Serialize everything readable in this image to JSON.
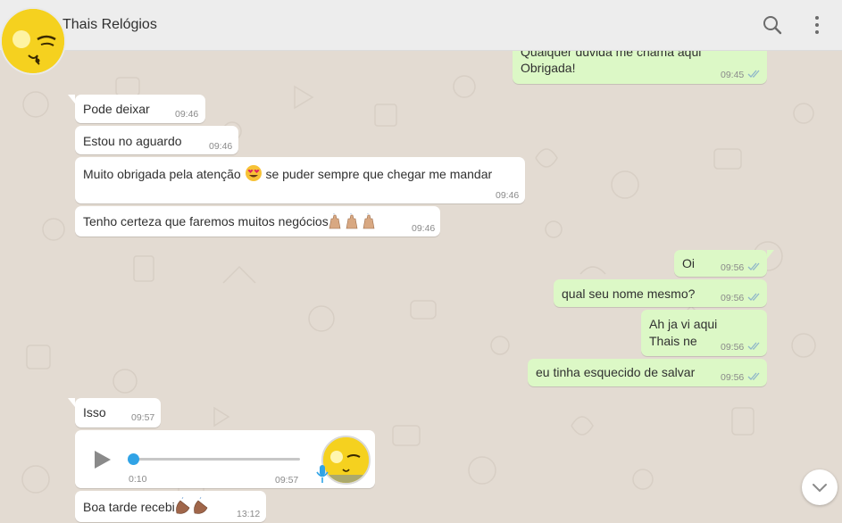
{
  "header": {
    "contact_name": "Thais Relógios",
    "search_icon": "search-icon",
    "menu_icon": "menu-icon"
  },
  "messages": [
    {
      "dir": "out",
      "text1": "Qualquer duvida me chama aqui",
      "text2": "Obrigada!",
      "time": "09:45",
      "status": "read"
    },
    {
      "dir": "in",
      "text": "Pode deixar",
      "time": "09:46"
    },
    {
      "dir": "in",
      "text": "Estou no aguardo",
      "time": "09:46"
    },
    {
      "dir": "in",
      "text_before": "Muito obrigada pela atenção",
      "emoji": "heart-eyes-emoji",
      "text_after": "se puder sempre que chegar me mandar",
      "time": "09:46"
    },
    {
      "dir": "in",
      "text": "Tenho certeza que faremos muitos negócios",
      "emoji": "raising-hands-emoji x3",
      "time": "09:46"
    },
    {
      "dir": "out",
      "text": "Oi",
      "time": "09:56",
      "status": "read"
    },
    {
      "dir": "out",
      "text": "qual seu nome mesmo?",
      "time": "09:56",
      "status": "read"
    },
    {
      "dir": "out",
      "text1": "Ah ja vi aqui",
      "text2": "Thais ne",
      "time": "09:56",
      "status": "read"
    },
    {
      "dir": "out",
      "text": "eu tinha esquecido de salvar",
      "time": "09:56",
      "status": "read"
    },
    {
      "dir": "in",
      "text": "Isso",
      "time": "09:57"
    },
    {
      "dir": "in",
      "type": "voice",
      "duration": "0:10",
      "time": "09:57",
      "progress": 0
    },
    {
      "dir": "in",
      "text": "Boa tarde recebi",
      "emoji": "clapping-hands-emoji x2",
      "time": "13:12"
    }
  ],
  "colors": {
    "incoming_bubble": "#ffffff",
    "outgoing_bubble": "#dcf8c6",
    "chat_background": "#e3dbd2",
    "read_ticks": "#4fc3f7",
    "audio_accent": "#30a3e6"
  }
}
